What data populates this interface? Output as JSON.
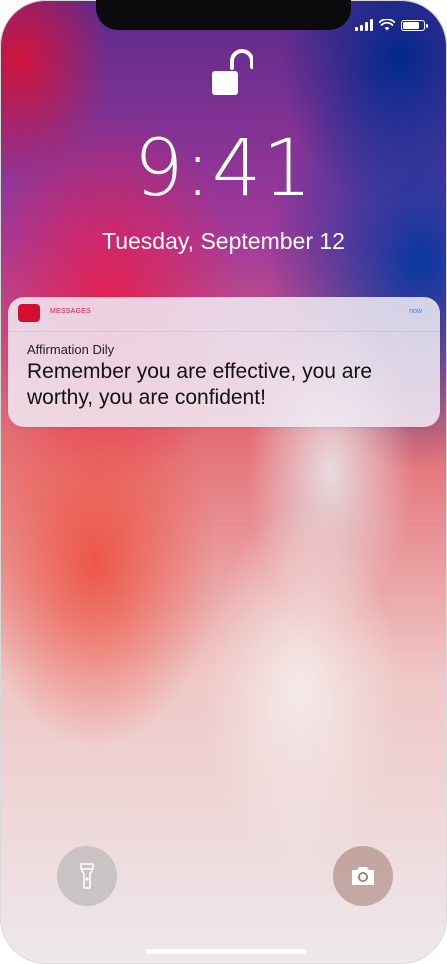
{
  "status_bar": {
    "signal_icon": "cellular-signal-icon",
    "wifi_icon": "wifi-icon",
    "battery_icon": "battery-icon"
  },
  "lock_icon": "unlocked-padlock-icon",
  "time": "9:41",
  "date": "Tuesday, September 12",
  "notification": {
    "app_icon": "messages-app-icon",
    "app_name": "MESSAGES",
    "time": "now",
    "title": "Affirmation Dily",
    "body": "Remember you are effective, you are worthy, you are confident!"
  },
  "quick_actions": {
    "flashlight_icon": "flashlight-icon",
    "camera_icon": "camera-icon"
  },
  "colors": {
    "notification_accent": "#d20f2e",
    "app_name_color": "#d7194e",
    "time_color": "#4a7bd6"
  }
}
